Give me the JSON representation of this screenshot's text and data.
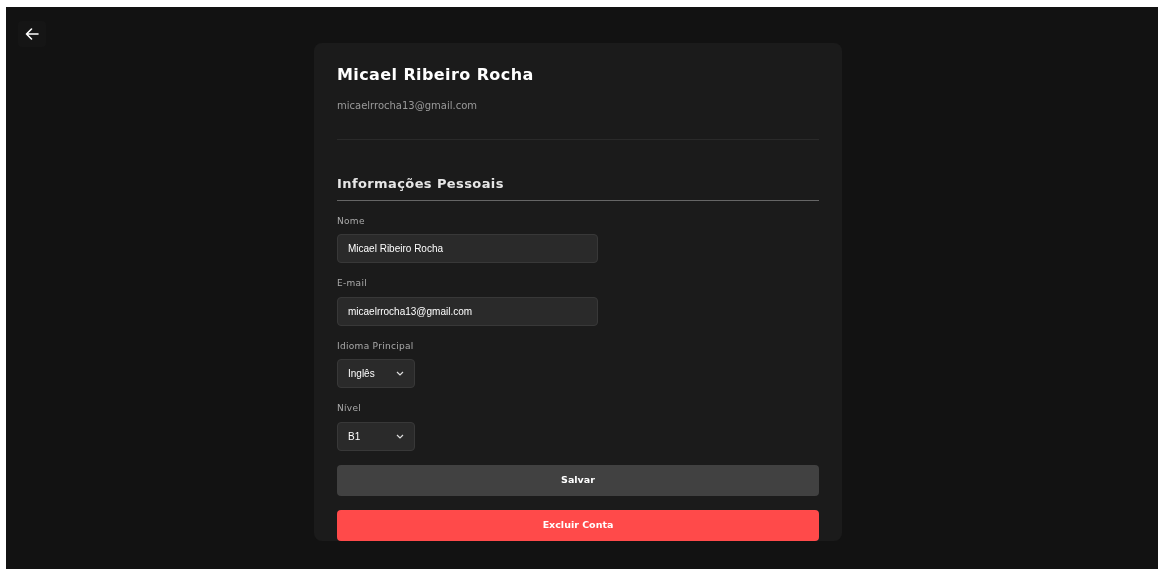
{
  "profile": {
    "name": "Micael Ribeiro Rocha",
    "email": "micaelrrocha13@gmail.com"
  },
  "section": {
    "title": "Informações Pessoais"
  },
  "fields": [
    {
      "kind": "text",
      "label": "Nome",
      "value": "Micael Ribeiro Rocha"
    },
    {
      "kind": "text",
      "label": "E-mail",
      "value": "micaelrrocha13@gmail.com"
    },
    {
      "kind": "select",
      "label": "Idioma Principal",
      "value": "Inglês"
    },
    {
      "kind": "select",
      "label": "Nível",
      "value": "B1"
    }
  ],
  "buttons": [
    {
      "kind": "primary",
      "label": "Salvar"
    },
    {
      "kind": "danger",
      "label": "Excluir Conta"
    }
  ]
}
